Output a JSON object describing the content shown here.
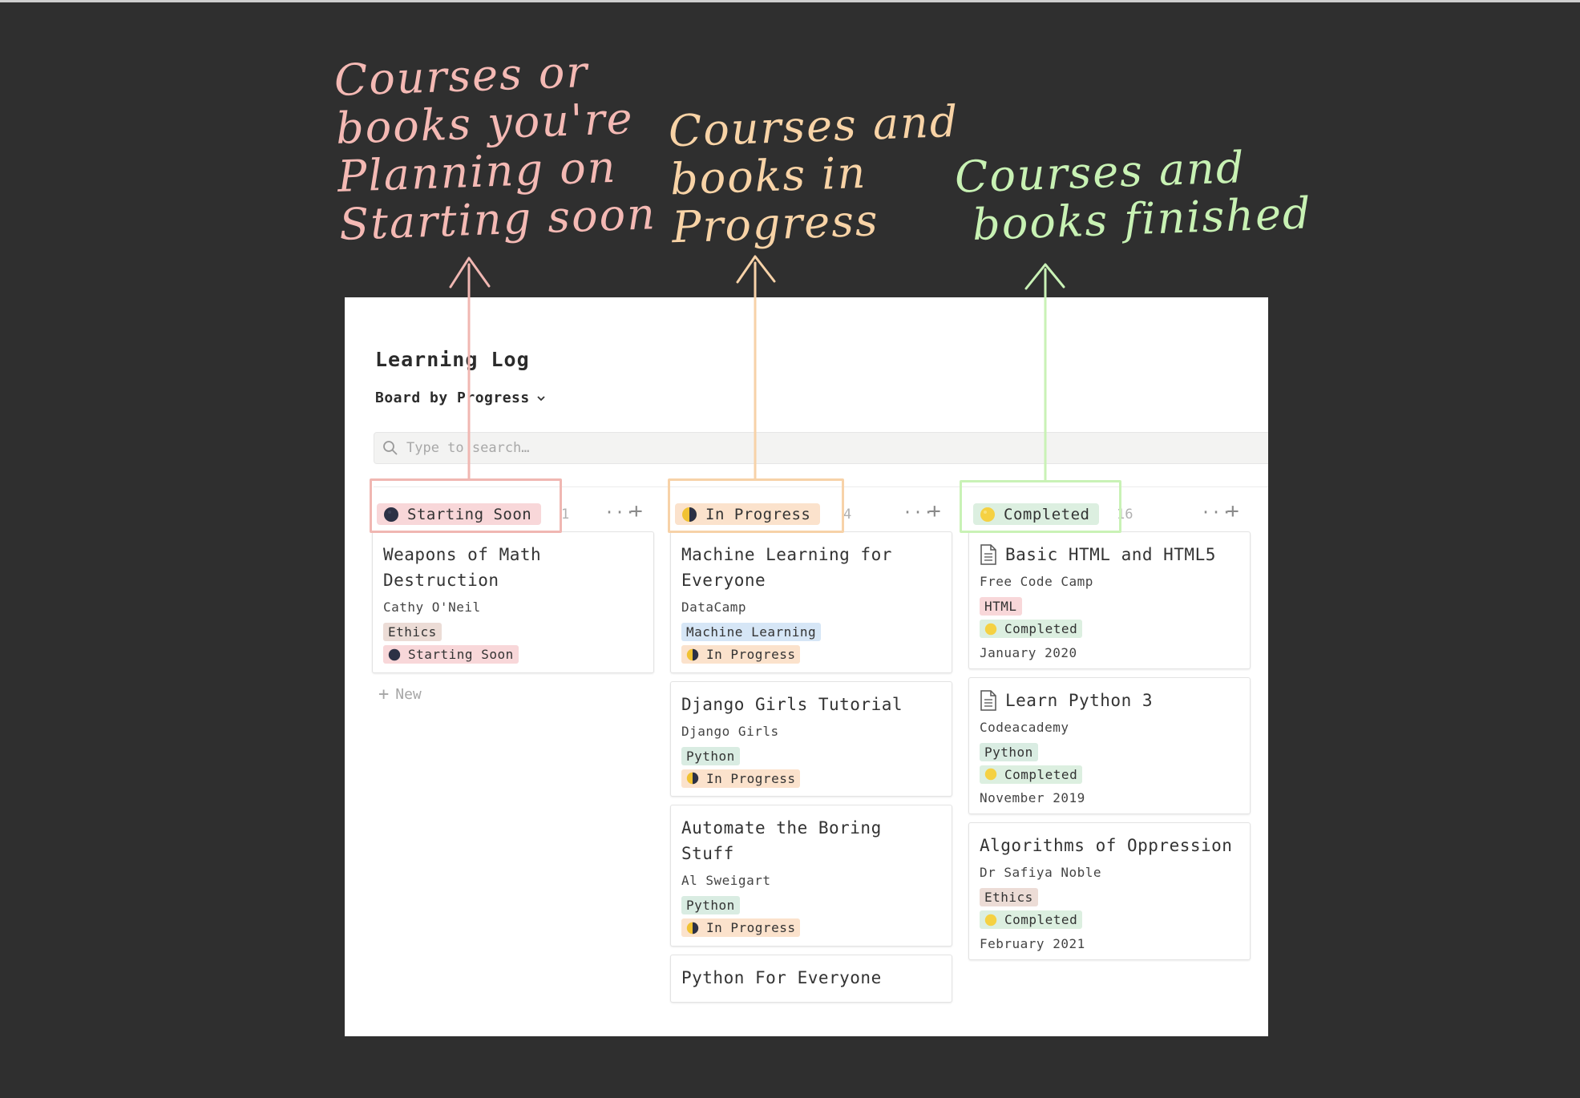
{
  "annotations": {
    "starting": [
      "Courses or",
      "books you're",
      "Planning on",
      "Starting soon"
    ],
    "progress": [
      "Courses and",
      "books in",
      "Progress"
    ],
    "completed": [
      "Courses and",
      "books finished"
    ]
  },
  "colors": {
    "starting_note": "#f4b9b4",
    "progress_note": "#f8d3a6",
    "completed_note": "#c8f2b4",
    "starting_pill": "#f8d7d9",
    "progress_pill": "#fbe2cc",
    "completed_pill": "#dcefe0",
    "tag_ethics": "#ecdcd6",
    "tag_html": "#f8d7d9",
    "tag_ml": "#d6e6f6",
    "tag_python": "#d9ece2"
  },
  "app": {
    "title": "Learning Log",
    "view_label": "Board by Progress",
    "search_placeholder": "Type to search…",
    "new_label": "New"
  },
  "columns": [
    {
      "label": "Starting Soon",
      "count": "1",
      "cards": [
        {
          "title": "Weapons of Math Destruction",
          "source": "Cathy O'Neil",
          "tag": "Ethics",
          "status": "Starting Soon"
        }
      ]
    },
    {
      "label": "In Progress",
      "count": "4",
      "cards": [
        {
          "title": "Machine Learning for Everyone",
          "source": "DataCamp",
          "tag": "Machine Learning",
          "status": "In Progress"
        },
        {
          "title": "Django Girls Tutorial",
          "source": "Django Girls",
          "tag": "Python",
          "status": "In Progress"
        },
        {
          "title": "Automate the Boring Stuff",
          "source": "Al Sweigart",
          "tag": "Python",
          "status": "In Progress"
        },
        {
          "title": "Python For Everyone"
        }
      ]
    },
    {
      "label": "Completed",
      "count": "16",
      "cards": [
        {
          "title": "Basic HTML and HTML5",
          "source": "Free Code Camp",
          "tag": "HTML",
          "status": "Completed",
          "date": "January 2020"
        },
        {
          "title": "Learn Python 3",
          "source": "Codeacademy",
          "tag": "Python",
          "status": "Completed",
          "date": "November 2019"
        },
        {
          "title": "Algorithms of Oppression",
          "source": "Dr Safiya Noble",
          "tag": "Ethics",
          "status": "Completed",
          "date": "February 2021"
        }
      ]
    }
  ]
}
